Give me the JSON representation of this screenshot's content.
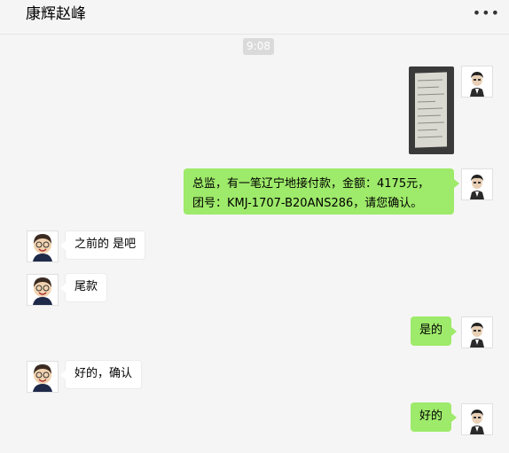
{
  "header": {
    "title": "康辉赵峰",
    "more_icon": "more-dots-icon"
  },
  "timestamp": "9:08",
  "messages": [
    {
      "side": "me",
      "type": "image",
      "content_icon": "document-photo"
    },
    {
      "side": "me",
      "text_line1": "总监，有一笔辽宁地接付款，金额：4175元，",
      "text_line2": "团号：KMJ-1707-B20ANS286，请您确认。"
    },
    {
      "side": "other",
      "text": "之前的 是吧"
    },
    {
      "side": "other",
      "text": "尾款"
    },
    {
      "side": "me",
      "text": "是的"
    },
    {
      "side": "other",
      "text": "好的，确认"
    },
    {
      "side": "me",
      "text": "好的"
    }
  ],
  "colors": {
    "me_bubble": "#9eea6a",
    "other_bubble": "#ffffff",
    "background": "#f5f5f5"
  }
}
